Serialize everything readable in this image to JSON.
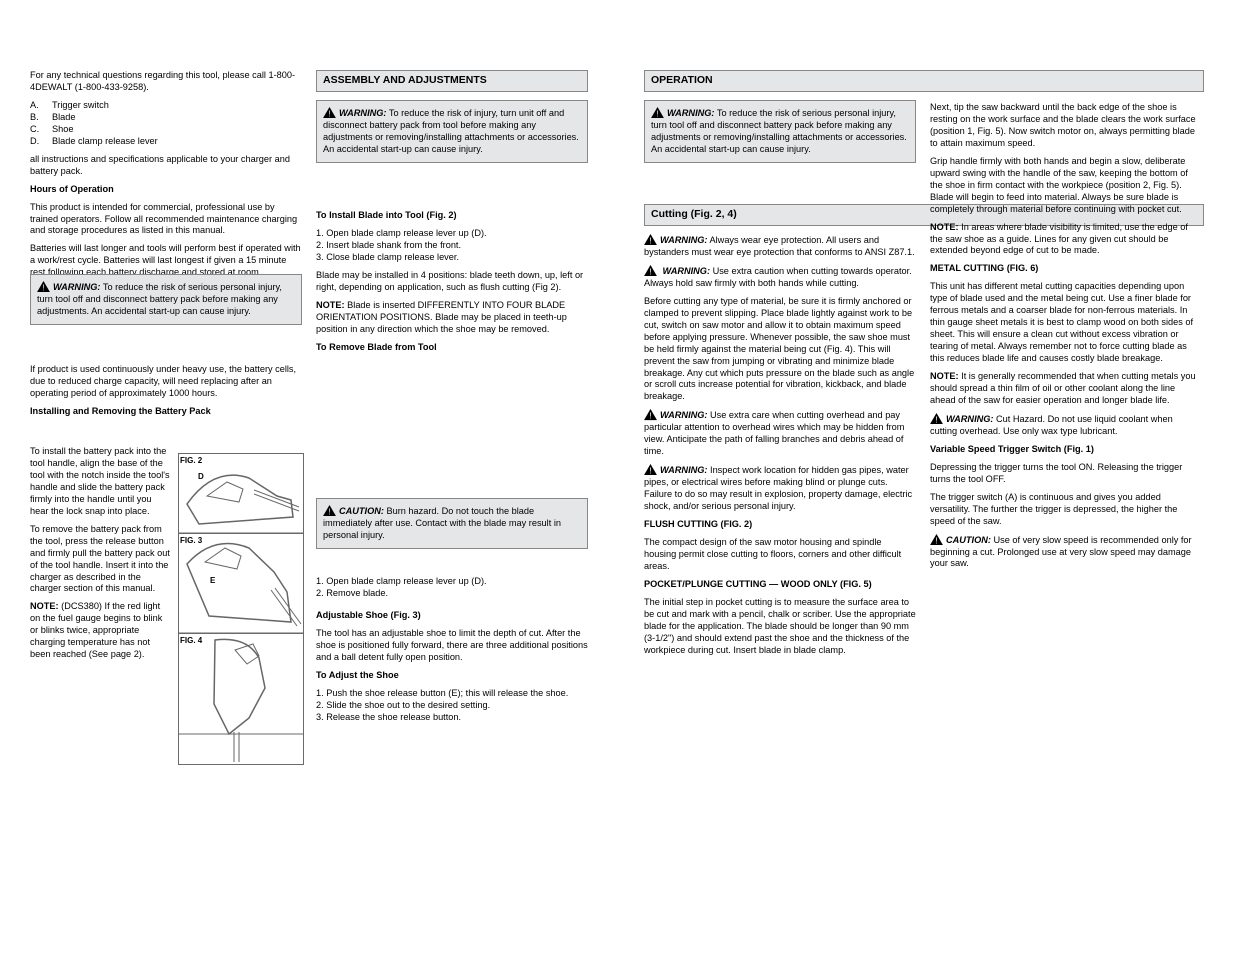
{
  "col1": {
    "p1": "For any technical questions regarding this tool, please call 1-800-4DEWALT (1-800-433-9258).",
    "p2_key": "A.",
    "p2_val": "Trigger switch",
    "p3_key": "B.",
    "p3_val": "Blade",
    "p4_key": "C.",
    "p4_val": "Shoe",
    "p5_key": "D.",
    "p5_val": "Blade clamp release lever",
    "p6": "all instructions and specifications applicable to your charger and battery pack.",
    "p7_lead": "Hours of Operation",
    "p7": "This product is intended for commercial, professional use by trained operators. Follow all recommended maintenance charging and storage procedures as listed in this manual.",
    "p8": "Batteries will last longer and tools will perform best if operated with a work/rest cycle. Batteries will last longest if given a 15 minute rest following each battery discharge and stored at room temperature.",
    "p9": "If product is used continuously under heavy use, the battery cells, due to reduced charge capacity, will need replacing after an operating period of approximately 1000 hours.",
    "p10_lead": "Installing and Removing the Battery Pack",
    "p11": "To install the battery pack into the tool handle, align the base of the tool with the notch inside the tool's handle and slide the battery pack firmly into the handle until you hear the lock snap into place.",
    "p12": "To remove the battery pack from the tool, press the release button and firmly pull the battery pack out of the tool handle. Insert it into the charger as described in the charger section of this manual.",
    "p13_lead": "NOTE:",
    "p13": " (DCS380) If the red light on the fuel gauge begins to blink or blinks twice, appropriate charging temperature has not been reached (See page 2)."
  },
  "col2": {
    "bar_assembly": "ASSEMBLY AND ADJUSTMENTS",
    "warn1_lead": "WARNING:",
    "warn1": " To reduce the risk of injury, turn unit off and disconnect battery pack from tool before making any adjustments or removing/installing attachments or accessories. An accidental start-up can cause injury.",
    "p1_lead": "To Install Blade into Tool (Fig. 2)",
    "p2": "1. Open blade clamp release lever up (D).",
    "p3": "2. Insert blade shank from the front.",
    "p4": "3. Close blade clamp release lever.",
    "p5": "Blade may be installed in 4 positions: blade teeth down, up, left or right, depending on application, such as flush cutting (Fig 2).",
    "p6_lead": "NOTE:",
    "p6": " Blade is inserted DIFFERENTLY INTO FOUR BLADE ORIENTATION POSITIONS. Blade may be placed in teeth-up position in any direction which the shoe may be removed.",
    "p7_lead": "To Remove Blade from Tool",
    "warn2_lead": "CAUTION:",
    "warn2": " Burn hazard. Do not touch the blade immediately after use. Contact with the blade may result in personal injury.",
    "p8": "1. Open blade clamp release lever up (D).",
    "p9": "2. Remove blade.",
    "p10_lead": "Adjustable Shoe (Fig. 3)",
    "p11": "The tool has an adjustable shoe to limit the depth of cut. After the shoe is positioned fully forward, there are three additional positions and a ball detent fully open position.",
    "p12_lead": "To Adjust the Shoe",
    "p13": "1. Push the shoe release button (E); this will release the shoe.",
    "p14": "2. Slide the shoe out to the desired setting.",
    "p15": "3. Release the shoe release button."
  },
  "col3": {
    "bar_op": "OPERATION",
    "warn1_lead": "WARNING:",
    "warn1": " To reduce the risk of serious personal injury, turn tool off and disconnect battery pack before making any adjustments or removing/installing attachments or accessories. An accidental start-up can cause injury.",
    "bar_cutting": "Cutting (Fig. 2, 4)",
    "warn2_lead": "WARNING:",
    "warn2": " Always wear eye protection. All users and bystanders must wear eye protection that conforms to ANSI Z87.1.",
    "warn3_lead": " WARNING:",
    "warn3": " Use extra caution when cutting towards operator. Always hold saw firmly with both hands while cutting.",
    "p1": "Before cutting any type of material, be sure it is firmly anchored or clamped to prevent slipping. Place blade lightly against work to be cut, switch on saw motor and allow it to obtain maximum speed before applying pressure. Whenever possible, the saw shoe must be held firmly against the material being cut (Fig. 4). This will prevent the saw from jumping or vibrating and minimize blade breakage. Any cut which puts pressure on the blade such as angle or scroll cuts increase potential for vibration, kickback, and blade breakage.",
    "warn4_lead": "WARNING:",
    "warn4": " Use extra care when cutting overhead and pay particular attention to overhead wires which may be hidden from view. Anticipate the path of falling branches and debris ahead of time.",
    "warn5_lead": "WARNING:",
    "warn5": " Inspect work location for hidden gas pipes, water pipes, or electrical wires before making blind or plunge cuts. Failure to do so may result in explosion, property damage, electric shock, and/or serious personal injury.",
    "p2_lead": "FLUSH CUTTING (FIG. 2)",
    "p3": "The compact design of the saw motor housing and spindle housing permit close cutting to floors, corners and other difficult areas.",
    "p4_lead": "POCKET/PLUNGE CUTTING — WOOD ONLY (FIG. 5)",
    "p5": "The initial step in pocket cutting is to measure the surface area to be cut and mark with a pencil, chalk or scriber. Use the appropriate blade for the application. The blade should be longer than 90 mm (3-1/2\") and should extend past the shoe and the thickness of the workpiece during cut. Insert blade in blade clamp."
  },
  "col4": {
    "p1": "Next, tip the saw backward until the back edge of the shoe is resting on the work surface and the blade clears the work surface (position 1, Fig. 5). Now switch motor on, always permitting blade to attain maximum speed.",
    "p2": "Grip handle firmly with both hands and begin a slow, deliberate upward swing with the handle of the saw, keeping the bottom of the shoe in firm contact with the workpiece (position 2, Fig. 5). Blade will begin to feed into material. Always be sure blade is completely through material before continuing with pocket cut.",
    "p3_lead": "NOTE:",
    "p3": " In areas where blade visibility is limited, use the edge of the saw shoe as a guide. Lines for any given cut should be extended beyond edge of cut to be made.",
    "p4_lead": "METAL CUTTING (FIG. 6)",
    "p5": "This unit has different metal cutting capacities depending upon type of blade used and the metal being cut. Use a finer blade for ferrous metals and a coarser blade for non-ferrous materials. In thin gauge sheet metals it is best to clamp wood on both sides of sheet. This will ensure a clean cut without excess vibration or tearing of metal. Always remember not to force cutting blade as this reduces blade life and causes costly blade breakage.",
    "p6_lead": "NOTE:",
    "p6": " It is generally recommended that when cutting metals you should spread a thin film of oil or other coolant along the line ahead of the saw for easier operation and longer blade life.",
    "warn1_lead": "WARNING:",
    "warn1": " Cut Hazard. Do not use liquid coolant when cutting overhead. Use only wax type lubricant.",
    "p7_lead": "Variable Speed Trigger Switch (Fig. 1)",
    "p8": "Depressing the trigger turns the tool ON. Releasing the trigger turns the tool OFF.",
    "p9": "The trigger switch (A) is continuous and gives you added versatility. The further the trigger is depressed, the higher the speed of the saw.",
    "warn2_lead": "CAUTION:",
    "warn2": " Use of very slow speed is recommended only for beginning a cut. Prolonged use at very slow speed may damage your saw."
  },
  "figs": {
    "fig2": "FIG. 2",
    "fig2d": "D",
    "fig3": "FIG. 3",
    "fig3e": "E",
    "fig4": "FIG. 4"
  },
  "warn_generic": {
    "lead": "WARNING:",
    "body": " To reduce the risk of serious personal injury, turn tool off and disconnect battery pack before making any adjustments. An accidental start-up can cause injury."
  }
}
